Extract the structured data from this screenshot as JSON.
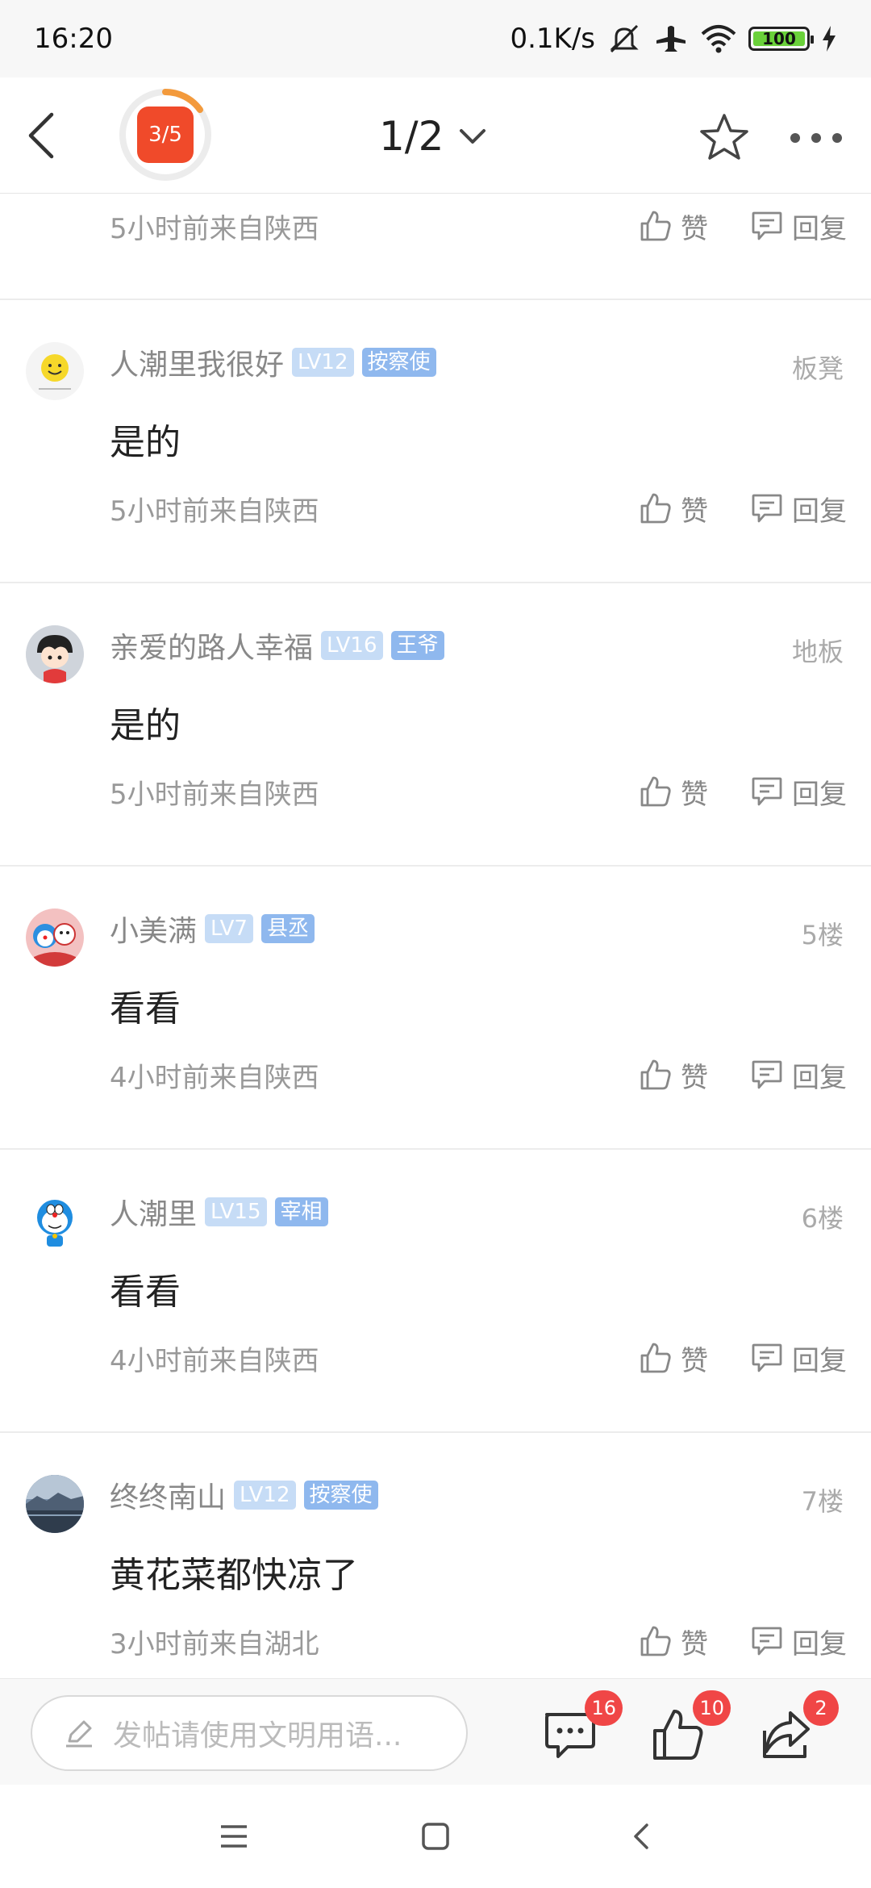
{
  "status_bar": {
    "time": "16:20",
    "net_speed": "0.1K/s",
    "battery": "100"
  },
  "header": {
    "read_progress": "3/5",
    "page": "1/2"
  },
  "partial_comment": {
    "meta": "5小时前来自陕西",
    "like_label": "赞",
    "reply_label": "回复"
  },
  "comments": [
    {
      "username": "人潮里我很好",
      "level": "LV12",
      "title": "按察使",
      "floor": "板凳",
      "content": "是的",
      "meta": "5小时前来自陕西",
      "like_label": "赞",
      "reply_label": "回复"
    },
    {
      "username": "亲爱的路人幸福",
      "level": "LV16",
      "title": "王爷",
      "floor": "地板",
      "content": "是的",
      "meta": "5小时前来自陕西",
      "like_label": "赞",
      "reply_label": "回复"
    },
    {
      "username": "小美满",
      "level": "LV7",
      "title": "县丞",
      "floor": "5楼",
      "content": "看看",
      "meta": "4小时前来自陕西",
      "like_label": "赞",
      "reply_label": "回复"
    },
    {
      "username": "人潮里",
      "level": "LV15",
      "title": "宰相",
      "floor": "6楼",
      "content": "看看",
      "meta": "4小时前来自陕西",
      "like_label": "赞",
      "reply_label": "回复"
    },
    {
      "username": "终终南山",
      "level": "LV12",
      "title": "按察使",
      "floor": "7楼",
      "content": "黄花菜都快凉了",
      "meta": "3小时前来自湖北",
      "like_label": "赞",
      "reply_label": "回复"
    }
  ],
  "bottom_bar": {
    "compose_placeholder": "发帖请使用文明用语...",
    "comment_count": "16",
    "like_count": "10",
    "share_count": "2"
  },
  "colors": {
    "accent": "#f04a2a",
    "badge_red": "#f04646",
    "level_tag": "#c6dcf6",
    "title_tag": "#8fb8ee"
  }
}
